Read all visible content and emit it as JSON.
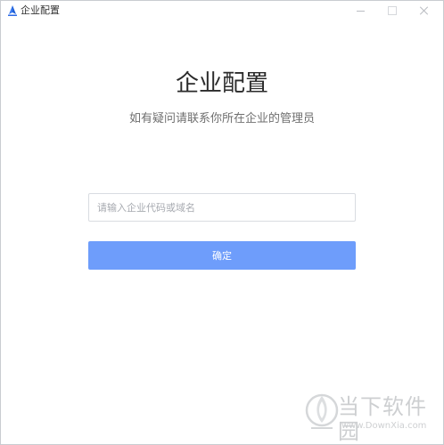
{
  "window": {
    "title": "企业配置",
    "app_icon": "app-logo-icon",
    "controls": {
      "minimize_icon": "minimize-icon",
      "maximize_icon": "maximize-icon",
      "close_icon": "close-icon"
    }
  },
  "main": {
    "heading": "企业配置",
    "subheading": "如有疑问请联系你所在企业的管理员",
    "input": {
      "value": "",
      "placeholder": "请输入企业代码或域名"
    },
    "confirm_label": "确定"
  },
  "watermark": {
    "name": "当下软件园",
    "url": "www.DownXia.com"
  },
  "colors": {
    "accent_button": "#6e9dfb",
    "input_border": "#d9dce1",
    "heading_text": "#2b2b2b",
    "subheading_text": "#6f6f6f"
  }
}
